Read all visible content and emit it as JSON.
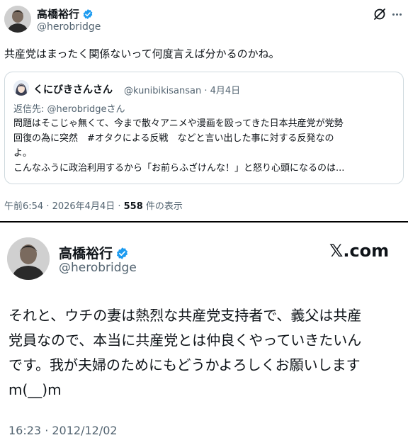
{
  "top_tweet": {
    "author_name": "高橋裕行",
    "author_handle": "@herobridge",
    "text": "共産党はまったく関係ないって何度言えば分かるのかね。",
    "quote": {
      "author_name": "くにびきさんさん",
      "author_handle": "@kunibikisansan",
      "date": "· 4月4日",
      "reply_to": "返信先: @herobridgeさん",
      "lines": [
        "問題はそこじゃ無くて、今まで散々アニメや漫画を殴ってきた日本共産党が党勢",
        "回復の為に突然　#オタクによる反戦　などと言い出した事に対する反発なの",
        "よ。",
        "こんなふうに政治利用するから「お前らふざけんな！」と怒り心頭になるのは..."
      ]
    },
    "timestamp": "午前6:54 · 2026年4月4日 · ",
    "views_count": "558",
    "views_label": " 件の表示"
  },
  "bottom_tweet": {
    "author_name": "高橋裕行",
    "author_handle": "@herobridge",
    "brand": "𝕏.com",
    "lines": [
      "それと、ウチの妻は熱烈な共産党支持者で、義父は共産",
      "党員なので、本当に共産党とは仲良くやっていきたいん",
      "です。我が夫婦のためにもどうかよろしくお願いします",
      "m(__)m"
    ],
    "timestamp": "16:23 · 2012/12/02"
  },
  "colors": {
    "verified": "#1d9bf0",
    "text": "#0f1419",
    "secondary": "#536471",
    "border": "#cfd9de"
  }
}
